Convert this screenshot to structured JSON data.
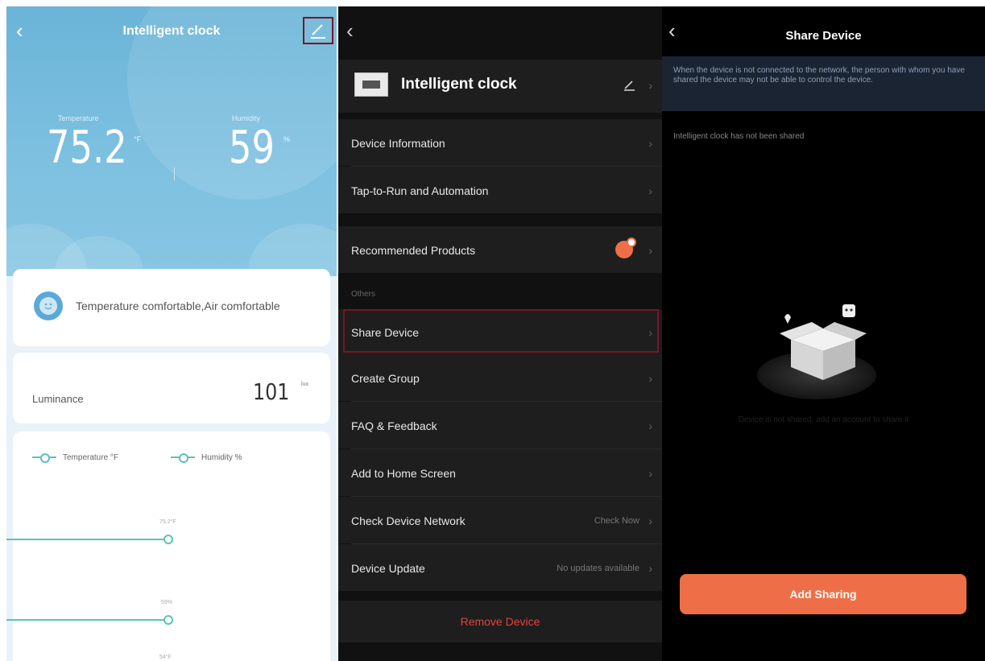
{
  "panel1": {
    "title": "Intelligent clock",
    "temperature": {
      "label": "Temperature",
      "value": "75.2",
      "unit": "°F"
    },
    "humidity": {
      "label": "Humidity",
      "value": "59",
      "unit": "%"
    },
    "comfort_text": "Temperature comfortable,Air comfortable",
    "luminance": {
      "label": "Luminance",
      "value": "101",
      "unit": "lux"
    },
    "chart": {
      "legend": [
        "Temperature °F",
        "Humidity %"
      ],
      "point_labels": [
        "75.2°F",
        "59%",
        "54°F"
      ]
    }
  },
  "panel2": {
    "device_name": "Intelligent clock",
    "section1": [
      "Device Information",
      "Tap-to-Run and Automation"
    ],
    "recommended": "Recommended Products",
    "others_label": "Others",
    "others": [
      {
        "label": "Share Device",
        "value": ""
      },
      {
        "label": "Create Group",
        "value": ""
      },
      {
        "label": "FAQ & Feedback",
        "value": ""
      },
      {
        "label": "Add to Home Screen",
        "value": ""
      },
      {
        "label": "Check Device Network",
        "value": "Check Now"
      },
      {
        "label": "Device Update",
        "value": "No updates available"
      }
    ],
    "remove": "Remove Device"
  },
  "panel3": {
    "title": "Share Device",
    "notice": "When the device is not connected to the network, the person with whom you have shared the device may not be able to control the device.",
    "status": "Intelligent clock  has not been shared",
    "empty_hint": "Device is not shared, add an account to share it",
    "button": "Add Sharing"
  },
  "colors": {
    "accent": "#ee6f47",
    "highlight_border": "#7a1526",
    "hero_blue": "#7dc0e0",
    "danger": "#e0453c"
  }
}
